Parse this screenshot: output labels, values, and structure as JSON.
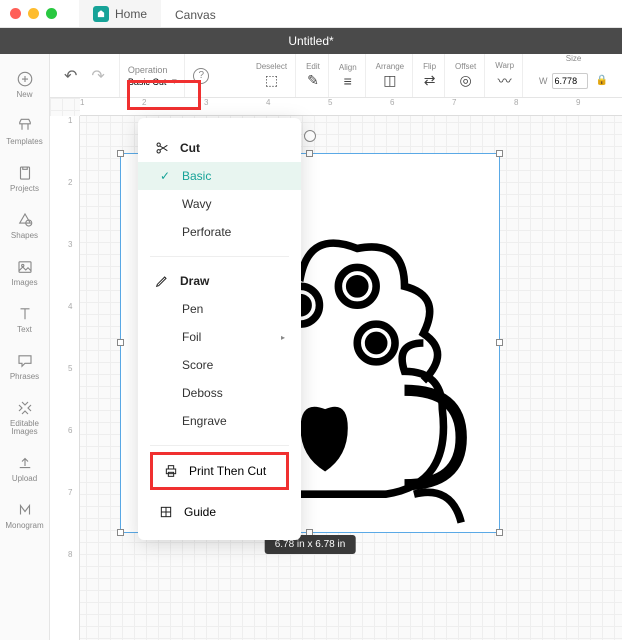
{
  "mac_tabs": {
    "home": "Home",
    "canvas": "Canvas"
  },
  "title": "Untitled*",
  "toolbar": {
    "operation_label": "Operation",
    "operation_value": "Basic Cut",
    "deselect": "Deselect",
    "edit": "Edit",
    "align": "Align",
    "arrange": "Arrange",
    "flip": "Flip",
    "offset": "Offset",
    "warp": "Warp",
    "size": "Size",
    "size_w_label": "W",
    "size_w_value": "6.778"
  },
  "sidebar": [
    {
      "label": "New"
    },
    {
      "label": "Templates"
    },
    {
      "label": "Projects"
    },
    {
      "label": "Shapes"
    },
    {
      "label": "Images"
    },
    {
      "label": "Text"
    },
    {
      "label": "Phrases"
    },
    {
      "label": "Editable Images"
    },
    {
      "label": "Upload"
    },
    {
      "label": "Monogram"
    }
  ],
  "ruler_h": [
    "1",
    "2",
    "3",
    "4",
    "5",
    "6",
    "7",
    "8",
    "9"
  ],
  "ruler_v": [
    "1",
    "2",
    "3",
    "4",
    "5",
    "6",
    "7",
    "8"
  ],
  "selection": {
    "size_text": "6.78  in x 6.78  in"
  },
  "dropdown": {
    "cut_header": "Cut",
    "cut_items": [
      "Basic",
      "Wavy",
      "Perforate"
    ],
    "cut_active": "Basic",
    "draw_header": "Draw",
    "draw_items": [
      {
        "label": "Pen",
        "submenu": false
      },
      {
        "label": "Foil",
        "submenu": true
      },
      {
        "label": "Score",
        "submenu": false
      },
      {
        "label": "Deboss",
        "submenu": false
      },
      {
        "label": "Engrave",
        "submenu": false
      }
    ],
    "print_then_cut": "Print Then Cut",
    "guide": "Guide"
  }
}
